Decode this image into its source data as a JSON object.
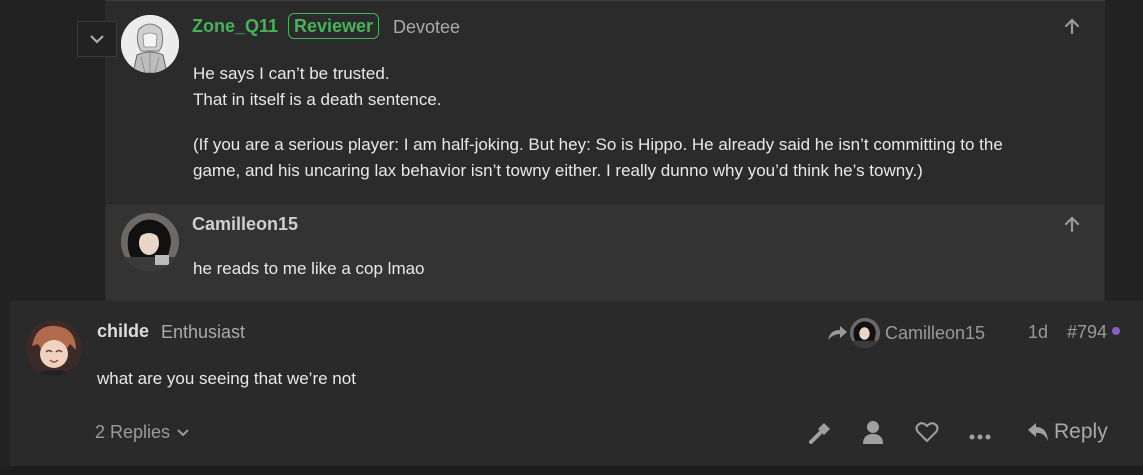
{
  "top_post": {
    "username": "Zone_Q11",
    "badge": "Reviewer",
    "flair": "Devotee",
    "lines": [
      "He says I can’t be trusted.",
      "That in itself is a death sentence."
    ],
    "paragraph_line1": "(If you are a serious player: I am half-joking. But hey: So is Hippo. He already said he isn’t committing to the",
    "paragraph_line2": "game, and his uncaring lax behavior isn’t towny either. I really dunno why you’d think he’s towny.)"
  },
  "nested_reply": {
    "username": "Camilleon15",
    "text": "he reads to me like a cop lmao"
  },
  "main_post": {
    "username": "childe",
    "flair": "Enthusiast",
    "reply_to": "Camilleon15",
    "age": "1d",
    "post_number": "#794",
    "text": "what are you seeing that we’re not",
    "replies_label": "2 Replies",
    "reply_button": "Reply"
  },
  "colors": {
    "reviewer_green": "#46b35b",
    "unread_dot": "#8b5cc6"
  }
}
